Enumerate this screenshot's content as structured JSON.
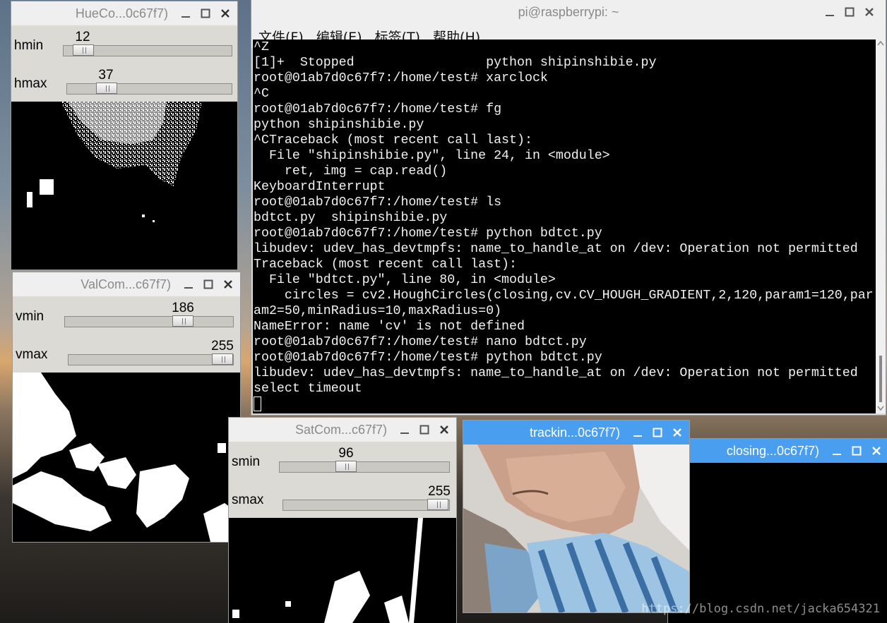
{
  "terminal": {
    "title": "pi@raspberrypi: ~",
    "menus": [
      "文件(F)",
      "编辑(E)",
      "标签(T)",
      "帮助(H)"
    ],
    "lines": [
      "^Z",
      "[1]+  Stopped                 python shipinshibie.py",
      "root@01ab7d0c67f7:/home/test# xarclock",
      "^C",
      "root@01ab7d0c67f7:/home/test# fg",
      "python shipinshibie.py",
      "^CTraceback (most recent call last):",
      "  File \"shipinshibie.py\", line 24, in <module>",
      "    ret, img = cap.read()",
      "KeyboardInterrupt",
      "root@01ab7d0c67f7:/home/test# ls",
      "bdtct.py  shipinshibie.py",
      "root@01ab7d0c67f7:/home/test# python bdtct.py",
      "libudev: udev_has_devtmpfs: name_to_handle_at on /dev: Operation not permitted",
      "Traceback (most recent call last):",
      "  File \"bdtct.py\", line 80, in <module>",
      "    circles = cv2.HoughCircles(closing,cv.CV_HOUGH_GRADIENT,2,120,param1=120,par",
      "am2=50,minRadius=10,maxRadius=0)",
      "NameError: name 'cv' is not defined",
      "root@01ab7d0c67f7:/home/test# nano bdtct.py",
      "root@01ab7d0c67f7:/home/test# python bdtct.py",
      "libudev: udev_has_devtmpfs: name_to_handle_at on /dev: Operation not permitted",
      "select timeout"
    ]
  },
  "hue_window": {
    "title": "HueCo...0c67f7)",
    "trackbars": [
      {
        "label": "hmin",
        "value": "12",
        "fraction": 0.12
      },
      {
        "label": "hmax",
        "value": "37",
        "fraction": 0.24
      }
    ]
  },
  "val_window": {
    "title": "ValCom...c67f7)",
    "trackbars": [
      {
        "label": "vmin",
        "value": "186",
        "fraction": 0.73
      },
      {
        "label": "vmax",
        "value": "255",
        "fraction": 1.0
      }
    ]
  },
  "sat_window": {
    "title": "SatCom...c67f7)",
    "trackbars": [
      {
        "label": "smin",
        "value": "96",
        "fraction": 0.38
      },
      {
        "label": "smax",
        "value": "255",
        "fraction": 1.0
      }
    ]
  },
  "tracking_window": {
    "title": "trackin...0c67f7)"
  },
  "closing_window": {
    "title": "closing...0c67f7)"
  },
  "watermark": "https://blog.csdn.net/jacka654321",
  "colors": {
    "active_titlebar": "#4a9ef0",
    "inactive_titlebar": "#efefef",
    "terminal_bg": "#000000"
  }
}
